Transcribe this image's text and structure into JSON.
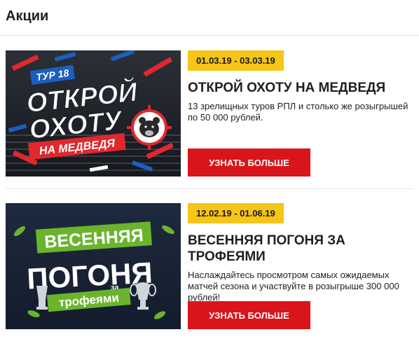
{
  "page": {
    "title": "Акции"
  },
  "promos": [
    {
      "date": "01.03.19 - 03.03.19",
      "title": "ОТКРОЙ ОХОТУ НА МЕДВЕДЯ",
      "description": "13 зрелищных туров РПЛ и столько же розыгрышей по 50 000 рублей.",
      "button": "УЗНАТЬ БОЛЬШЕ",
      "banner": {
        "tag": "ТУР 18",
        "line1": "ОТКРОЙ",
        "line2": "ОХОТУ",
        "ribbon": "НА МЕДВЕДЯ"
      }
    },
    {
      "date": "12.02.19 - 01.06.19",
      "title": "ВЕСЕННЯЯ ПОГОНЯ ЗА ТРОФЕЯМИ",
      "description": "Наслаждайтесь просмотром самых ожидаемых матчей сезона и участвуйте в розыгрыше 300 000 рублей!",
      "button": "УЗНАТЬ БОЛЬШЕ",
      "banner": {
        "line1": "ВЕСЕННЯЯ",
        "line2": "ПОГОНЯ",
        "small": "за",
        "line3": "трофеями"
      }
    }
  ],
  "colors": {
    "accent_yellow": "#f5c518",
    "button_red": "#d9141a",
    "banner_red": "#e0282e",
    "banner_blue": "#1b5fbf",
    "banner_green": "#6ab42d"
  }
}
